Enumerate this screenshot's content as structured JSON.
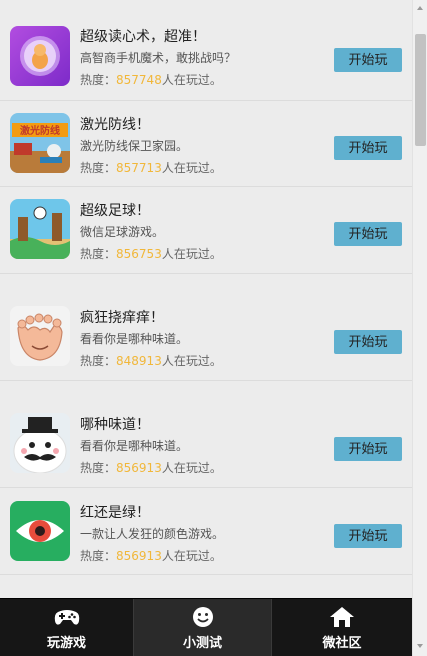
{
  "games": [
    {
      "title": "超级读心术，超准！",
      "desc": "高智商手机魔术，敢挑战吗？",
      "heat_prefix": "热度：",
      "heat_num": "857748",
      "heat_suffix": "人在玩过。",
      "button": "开始玩",
      "icon": "magic-ball-icon"
    },
    {
      "title": "激光防线！",
      "desc": "激光防线保卫家园。",
      "heat_prefix": "热度：",
      "heat_num": "857713",
      "heat_suffix": "人在玩过。",
      "button": "开始玩",
      "icon": "laser-defense-icon"
    },
    {
      "title": "超级足球！",
      "desc": "微信足球游戏。",
      "heat_prefix": "热度：",
      "heat_num": "856753",
      "heat_suffix": "人在玩过。",
      "button": "开始玩",
      "icon": "soccer-icon"
    },
    {
      "title": "疯狂挠痒痒！",
      "desc": "看看你是哪种味道。",
      "heat_prefix": "热度：",
      "heat_num": "848913",
      "heat_suffix": "人在玩过。",
      "button": "开始玩",
      "icon": "foot-icon"
    },
    {
      "title": "哪种味道！",
      "desc": "看看你是哪种味道。",
      "heat_prefix": "热度：",
      "heat_num": "856913",
      "heat_suffix": "人在玩过。",
      "button": "开始玩",
      "icon": "mustache-face-icon"
    },
    {
      "title": "红还是绿！",
      "desc": "一款让人发狂的颜色游戏。",
      "heat_prefix": "热度：",
      "heat_num": "856913",
      "heat_suffix": "人在玩过。",
      "button": "开始玩",
      "icon": "eye-icon"
    }
  ],
  "tabs": [
    {
      "label": "玩游戏",
      "icon": "gamepad-icon"
    },
    {
      "label": "小测试",
      "icon": "smiley-icon"
    },
    {
      "label": "微社区",
      "icon": "home-icon"
    }
  ],
  "colors": {
    "accent_button": "#5fb0cf",
    "heat_number": "#f1b73a",
    "tabbar": "#161616"
  }
}
